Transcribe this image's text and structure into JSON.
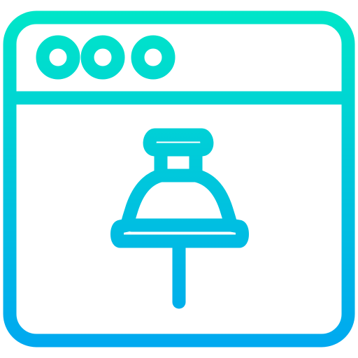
{
  "icon": {
    "name": "browser-window-pin-icon",
    "gradient_top": "#00E6C8",
    "gradient_bottom": "#00A8F0"
  }
}
